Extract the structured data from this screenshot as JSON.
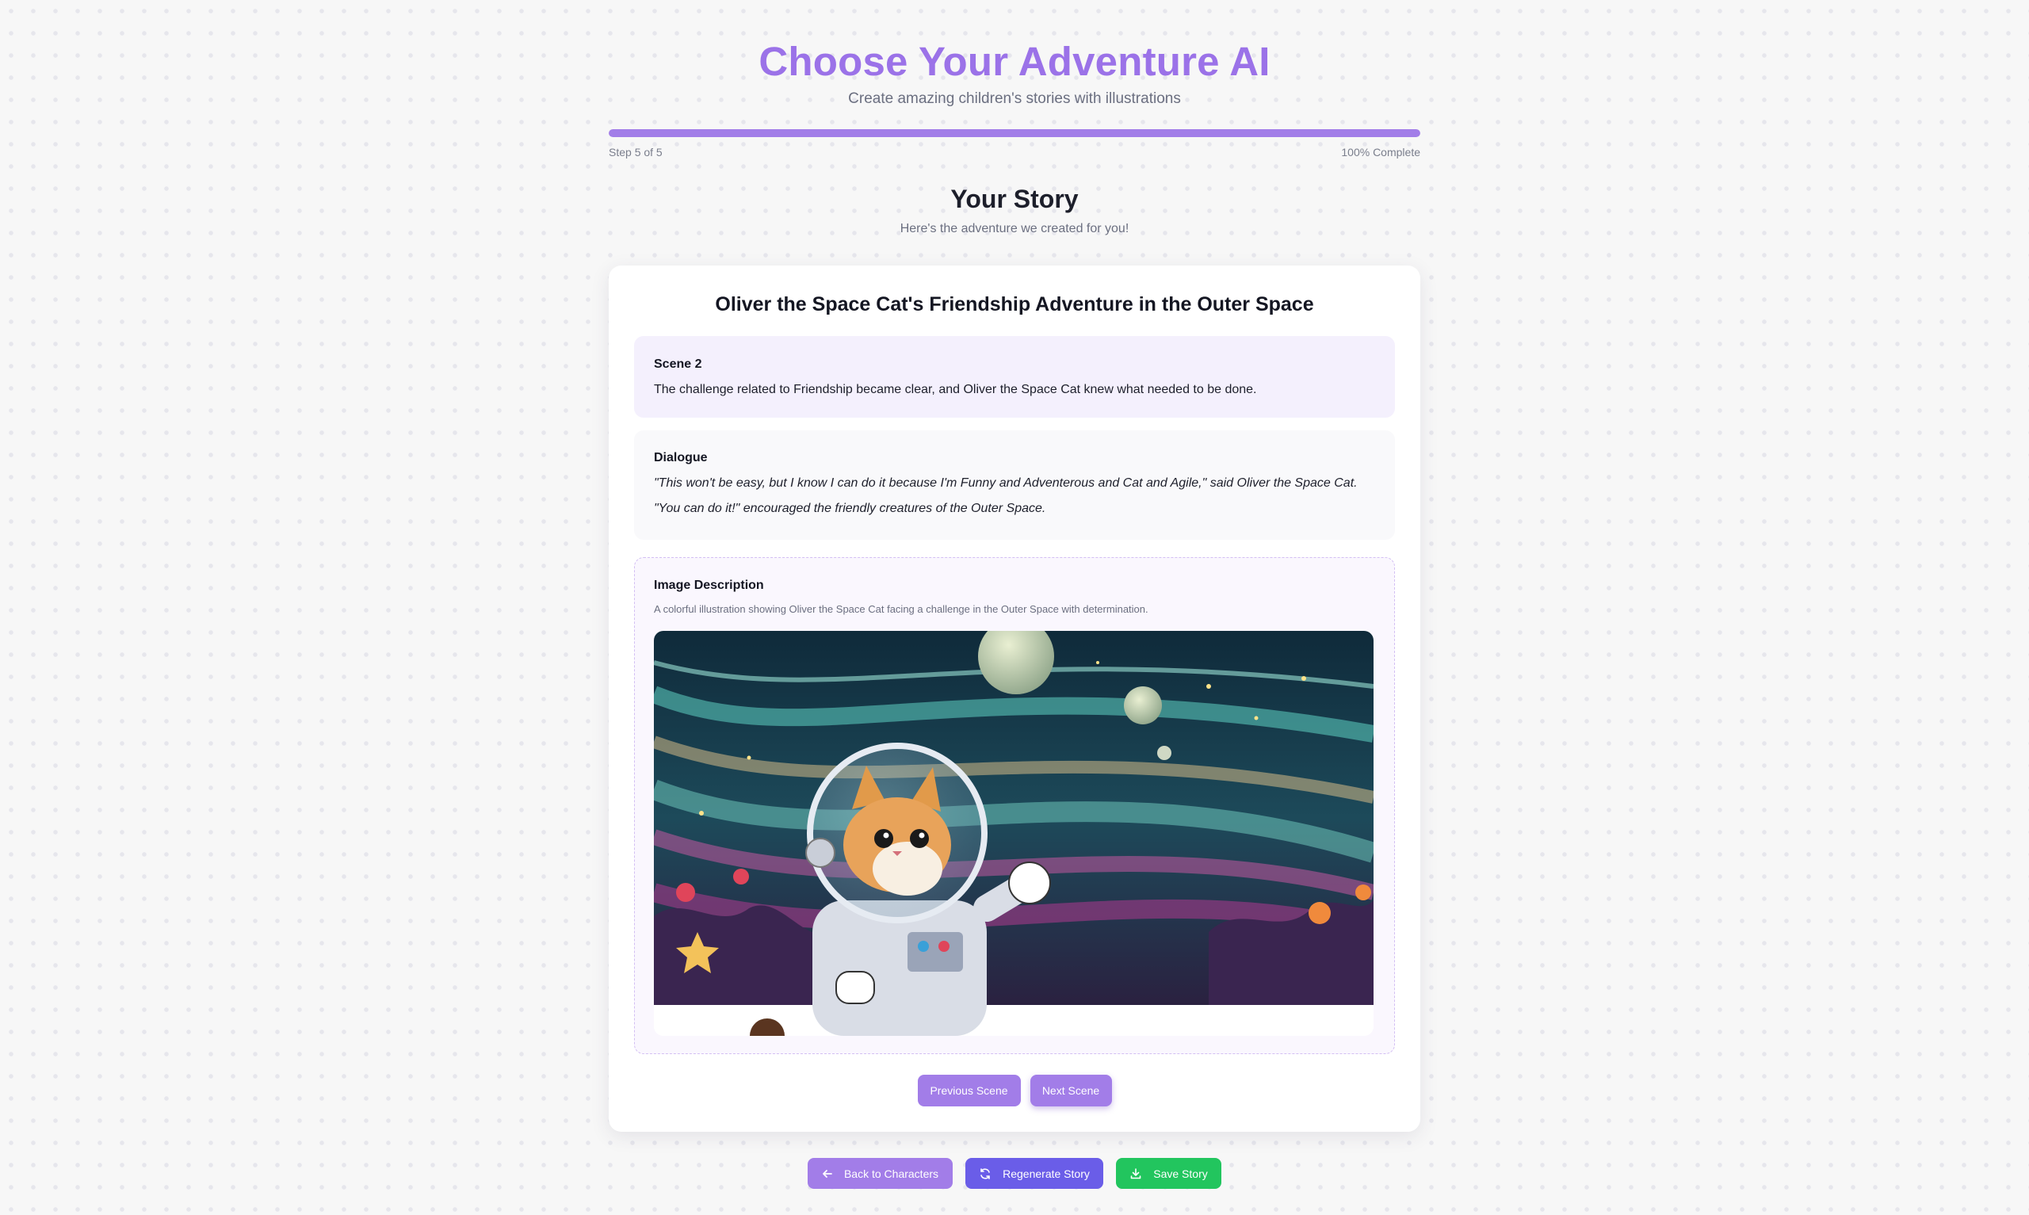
{
  "header": {
    "title": "Choose Your Adventure AI",
    "subtitle": "Create amazing children's stories with illustrations"
  },
  "progress": {
    "step_label": "Step 5 of 5",
    "percent_label": "100% Complete",
    "fraction": 1.0
  },
  "section": {
    "title": "Your Story",
    "subtitle": "Here's the adventure we created for you!"
  },
  "story": {
    "title": "Oliver the Space Cat's Friendship Adventure in the Outer Space",
    "scene": {
      "label": "Scene 2",
      "text": "The challenge related to Friendship became clear, and Oliver the Space Cat knew what needed to be done."
    },
    "dialogue": {
      "label": "Dialogue",
      "lines": [
        "\"This won't be easy, but I know I can do it because I'm Funny and Adventerous and Cat and Agile,\" said Oliver the Space Cat.",
        "\"You can do it!\" encouraged the friendly creatures of the Outer Space."
      ]
    },
    "image": {
      "label": "Image Description",
      "description": "A colorful illustration showing Oliver the Space Cat facing a challenge in the Outer Space with determination."
    }
  },
  "scene_nav": {
    "previous_label": "Previous Scene",
    "next_label": "Next Scene"
  },
  "actions": {
    "back_label": "Back to Characters",
    "regenerate_label": "Regenerate Story",
    "save_label": "Save Story"
  },
  "colors": {
    "accent": "#a27de8",
    "regenerate": "#6a5de8",
    "save": "#22c55e"
  },
  "icons": {
    "back": "arrow-left-icon",
    "regenerate": "refresh-icon",
    "save": "download-icon"
  }
}
